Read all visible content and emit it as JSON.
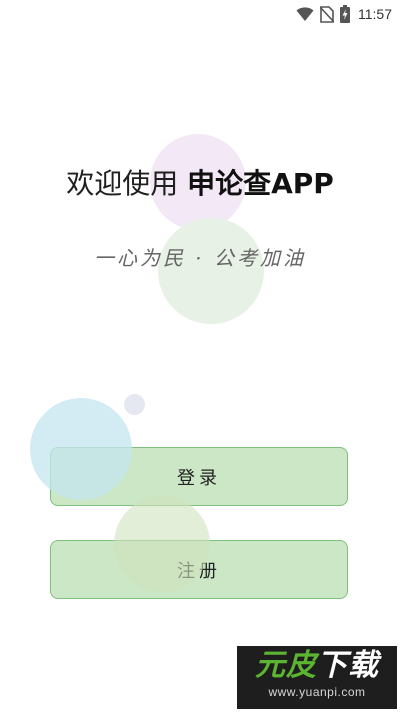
{
  "status_bar": {
    "time": "11:57",
    "icons": [
      "wifi-icon",
      "no-sim-icon",
      "battery-charging-icon"
    ]
  },
  "welcome": {
    "prefix": "欢迎使用 ",
    "app_name": "申论查APP"
  },
  "slogan": "一心为民 · 公考加油",
  "buttons": {
    "login_label": "登录",
    "register_label": "注册"
  },
  "watermark": {
    "logo_part1": "元皮",
    "logo_part2": "下载",
    "url": "www.yuanpi.com"
  },
  "colors": {
    "button_fill": "#c0e2ba",
    "button_border": "#7fc07c",
    "bubble_purple": "#f3e9f6",
    "bubble_green": "#e7f1e5",
    "bubble_teal": "#c4e6f0",
    "watermark_green": "#5cb531"
  }
}
